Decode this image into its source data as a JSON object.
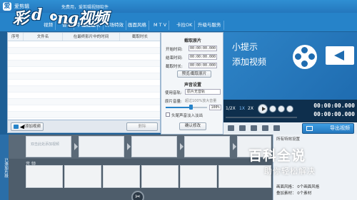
{
  "titlebar": {
    "app_name": "爱剪辑",
    "tagline": "免费用，爱剪辑视频软件"
  },
  "menu": {
    "tabs": [
      "视频",
      "音频",
      "字幕特效",
      "叠加素材",
      "转场特效",
      "画面风格",
      "M T V",
      "卡拉OK",
      "升级与服务"
    ]
  },
  "watermark": {
    "text_a": "彩",
    "text_b": "d",
    "text_c": "ng视频"
  },
  "clip_list": {
    "columns": [
      "序号",
      "文件名",
      "在最终影片中的时间",
      "截取时长"
    ]
  },
  "settings": {
    "section_clip": "截取原片",
    "start_label": "开始时间:",
    "start_value": "00:00:00.000",
    "end_label": "结束时间:",
    "end_value": "00:00:00.000",
    "duration_label": "截取时长:",
    "duration_value": "00:00:00.000",
    "preview_button": "预览/截取原片",
    "section_audio": "声音设置",
    "track_label": "使用音轨:",
    "track_value": "原片无音轨",
    "volume_label": "原片音量:",
    "volume_hint": "超过100%放大音量",
    "volume_value": "100%",
    "volume_level": 0.6,
    "fade_label": "头尾声音淡入淡出",
    "confirm_button": "确认修改"
  },
  "left_toolbar": {
    "add_video": "添加视频",
    "delete": "删除"
  },
  "preview": {
    "title": "小提示",
    "subtitle": "添加视频"
  },
  "controls": {
    "speeds": [
      "1/2X",
      "1X",
      "2X"
    ],
    "time_current": "00:00:00.000",
    "time_total": "00:00:00.000"
  },
  "export": {
    "label": "导出视频"
  },
  "timeline": {
    "side_tab": "已添加片段",
    "placeholder": "双击此处添加视频",
    "audio_label": "音 频"
  },
  "props": {
    "title": "所有特效设置",
    "style_label": "画面风格：",
    "style_value": "0个画面风格",
    "material_label": "叠加素材：",
    "material_value": "0个素材"
  },
  "overlay": {
    "title": "百科全说",
    "subtitle": "助你轻松解决"
  },
  "colors": {
    "accent": "#2683c9",
    "dark": "#0e2f4d"
  }
}
